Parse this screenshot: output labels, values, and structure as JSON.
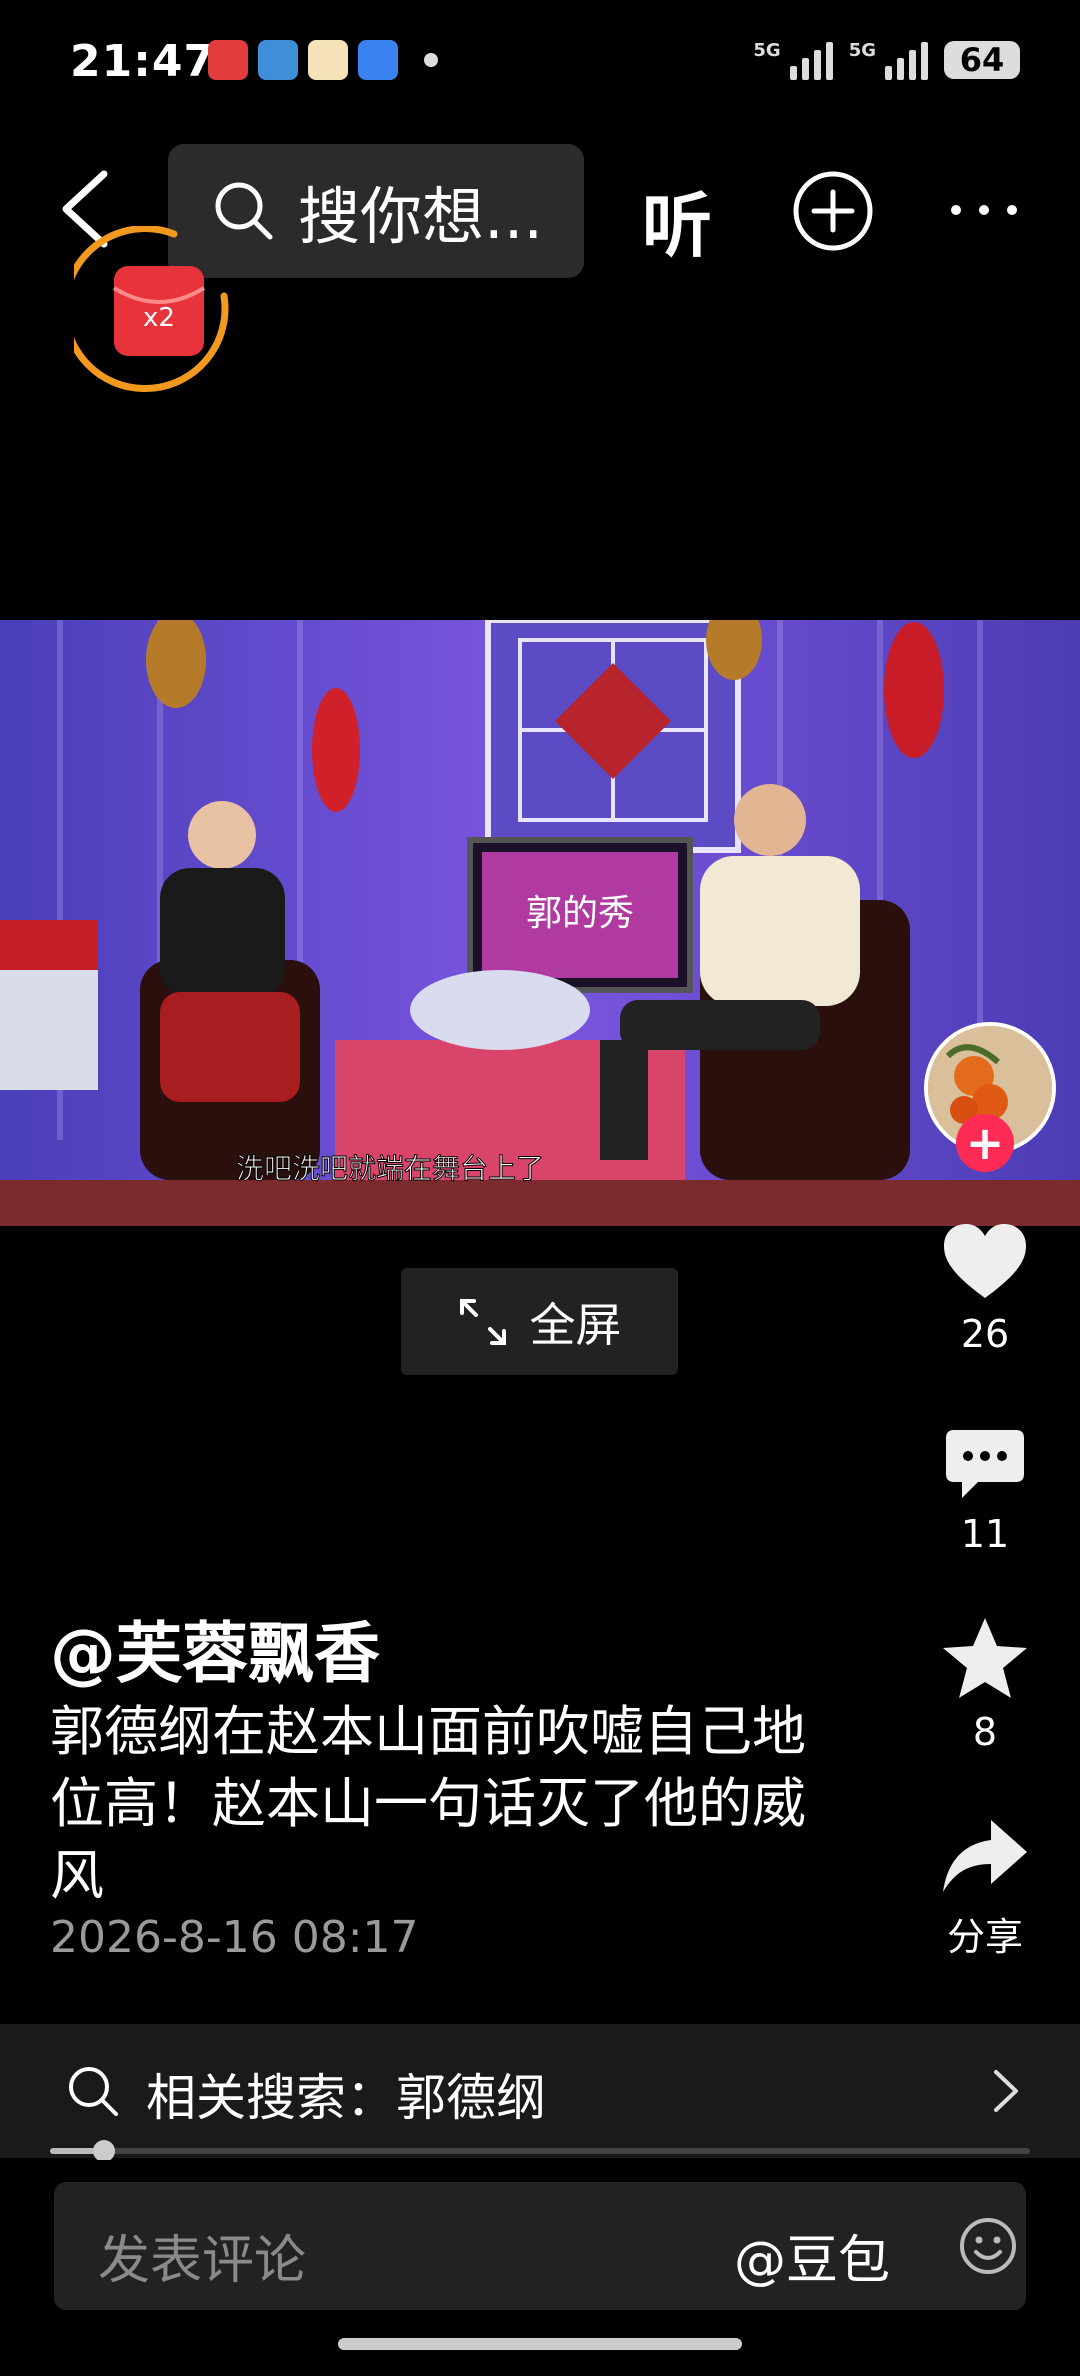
{
  "status_bar": {
    "time": "21:47",
    "network_1": "5G",
    "network_2": "5G",
    "battery": "64"
  },
  "nav": {
    "search_placeholder": "搜你想...",
    "listen_label": "听"
  },
  "badge": {
    "multiplier": "x2"
  },
  "video": {
    "subtitle": "洗吧洗吧就端在舞台上了",
    "screen_title": "郭的秀"
  },
  "fullscreen": {
    "label": "全屏"
  },
  "rail": {
    "likes": "26",
    "comments": "11",
    "favorites": "8",
    "share_label": "分享"
  },
  "post": {
    "author": "@芙蓉飘香",
    "description": "郭德纲在赵本山面前吹嘘自己地位高！赵本山一句话灭了他的威风",
    "date": "2026-8-16 08:17"
  },
  "related": {
    "text": "相关搜索：郭德纲"
  },
  "progress": {
    "fraction": 0.055
  },
  "comment": {
    "placeholder": "发表评论",
    "mention": "@豆包"
  },
  "colors": {
    "accent_red": "#fe2c55",
    "badge_orange": "#f39a1e"
  }
}
